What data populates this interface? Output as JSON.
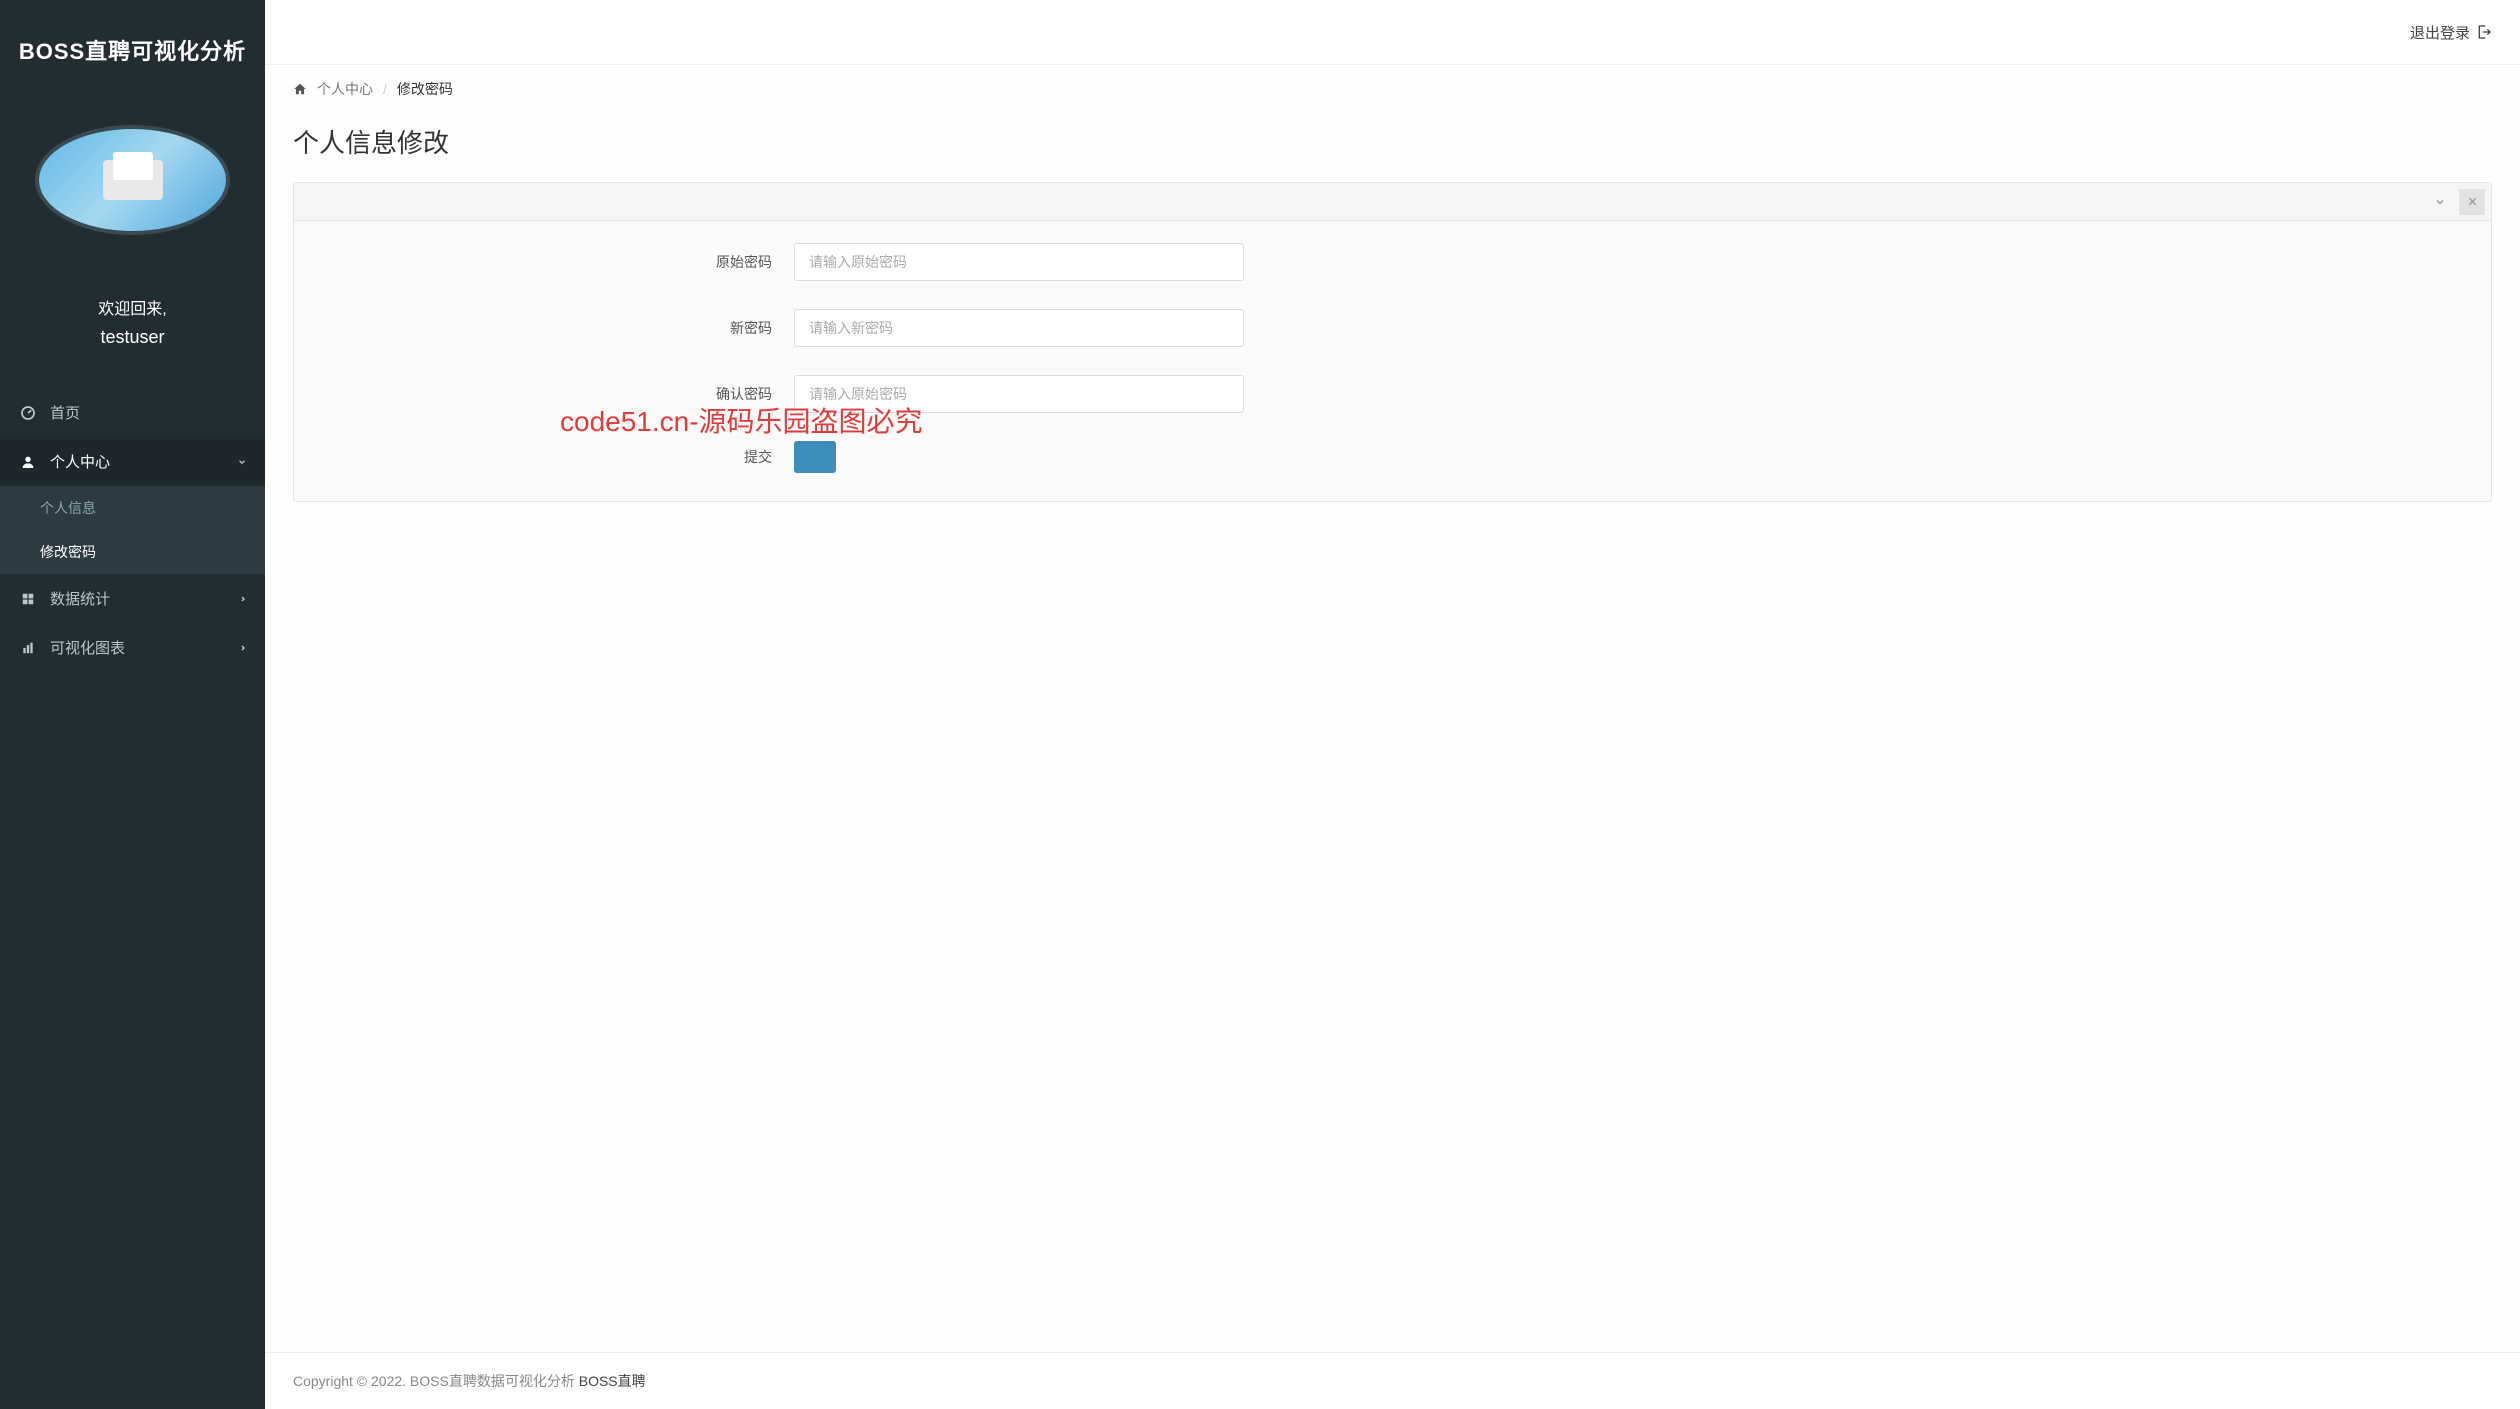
{
  "watermark": {
    "text": "code51.cn",
    "center_text": "code51.cn-源码乐园盗图必究"
  },
  "sidebar": {
    "title": "BOSS直聘可视化分析",
    "welcome": "欢迎回来,",
    "username": "testuser",
    "nav": {
      "home": "首页",
      "personal_center": "个人中心",
      "personal_info": "个人信息",
      "change_password": "修改密码",
      "data_stats": "数据统计",
      "visual_charts": "可视化图表"
    }
  },
  "topbar": {
    "logout": "退出登录"
  },
  "breadcrumb": {
    "parent": "个人中心",
    "current": "修改密码"
  },
  "page_title": "个人信息修改",
  "form": {
    "original_password": {
      "label": "原始密码",
      "placeholder": "请输入原始密码"
    },
    "new_password": {
      "label": "新密码",
      "placeholder": "请输入新密码"
    },
    "confirm_password": {
      "label": "确认密码",
      "placeholder": "请输入原始密码"
    },
    "submit_label": "提交"
  },
  "footer": {
    "copyright": "Copyright © 2022. BOSS直聘数据可视化分析 ",
    "link": "BOSS直聘"
  }
}
